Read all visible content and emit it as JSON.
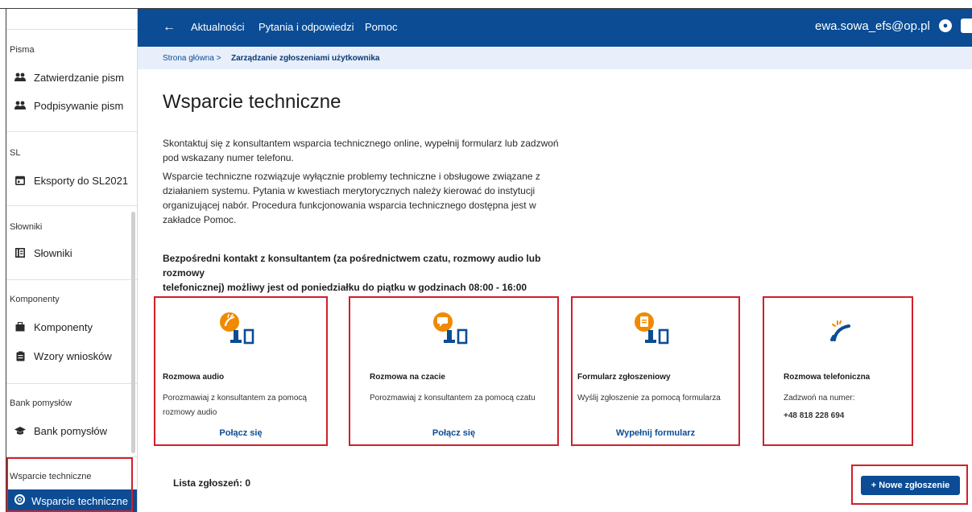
{
  "sidebar": {
    "sections": [
      {
        "heading": "Pisma",
        "items": [
          {
            "label": "Zatwierdzanie pism",
            "icon": "people-icon"
          },
          {
            "label": "Podpisywanie pism",
            "icon": "people-icon"
          }
        ]
      },
      {
        "heading": "SL",
        "items": [
          {
            "label": "Eksporty do SL2021",
            "icon": "calendar-icon"
          }
        ]
      },
      {
        "heading": "Słowniki",
        "items": [
          {
            "label": "Słowniki",
            "icon": "book-icon"
          }
        ]
      },
      {
        "heading": "Komponenty",
        "items": [
          {
            "label": "Komponenty",
            "icon": "box-icon"
          },
          {
            "label": "Wzory wniosków",
            "icon": "clipboard-icon"
          }
        ]
      },
      {
        "heading": "Bank pomysłów",
        "items": [
          {
            "label": "Bank pomysłów",
            "icon": "graduation-cap-icon"
          }
        ]
      },
      {
        "heading": "Wsparcie techniczne",
        "items": [
          {
            "label": "Wsparcie techniczne",
            "icon": "lifebuoy-icon"
          }
        ]
      }
    ]
  },
  "topbar": {
    "back_arrow": "←",
    "nav": [
      "Aktualności",
      "Pytania i odpowiedzi",
      "Pomoc"
    ],
    "user_email": "ewa.sowa_efs@op.pl"
  },
  "breadcrumb": {
    "home": "Strona główna >",
    "current": "Zarządzanie zgłoszeniami użytkownika"
  },
  "main": {
    "title": "Wsparcie techniczne",
    "intro_1": [
      "Skontaktuj się z konsultantem wsparcia technicznego online, wypełnij formularz lub zadzwoń",
      "pod wskazany numer telefonu."
    ],
    "intro_2": [
      "Wsparcie techniczne rozwiązuje wyłącznie problemy techniczne i obsługowe związane z",
      "działaniem systemu. Pytania w kwestiach merytorycznych należy kierować do instytucji",
      "organizującej nabór. Procedura funkcjonowania wsparcia technicznego dostępna jest w",
      "zakładce Pomoc."
    ],
    "contact_hours": [
      "Bezpośredni kontakt z konsultantem (za pośrednictwem czatu, rozmowy audio lub rozmowy",
      "telefonicznej) możliwy jest od poniedziałku do piątku w godzinach 08:00 - 16:00"
    ],
    "cards": [
      {
        "title": "Rozmowa audio",
        "desc": [
          "Porozmawiaj z konsultantem za pomocą",
          "rozmowy audio"
        ],
        "link": "Połącz się",
        "icon": "audio-call-icon"
      },
      {
        "title": "Rozmowa na czacie",
        "desc": [
          "Porozmawiaj z konsultantem za pomocą czatu"
        ],
        "link": "Połącz się",
        "icon": "chat-icon"
      },
      {
        "title": "Formularz zgłoszeniowy",
        "desc": [
          "Wyślij zgłoszenie za pomocą formularza"
        ],
        "link": "Wypełnij formularz",
        "icon": "form-icon"
      },
      {
        "title": "Rozmowa telefoniczna",
        "desc": [
          "Zadzwoń na numer:"
        ],
        "phone": "+48 818 228 694",
        "icon": "phone-icon"
      }
    ],
    "list_count": "Lista zgłoszeń: 0",
    "new_button": "+ Nowe zgłoszenie"
  },
  "colors": {
    "brand": "#0b4c94",
    "accent_orange": "#f08a00",
    "highlight_red": "#d0202a",
    "crumb_bg": "#e8effa"
  }
}
